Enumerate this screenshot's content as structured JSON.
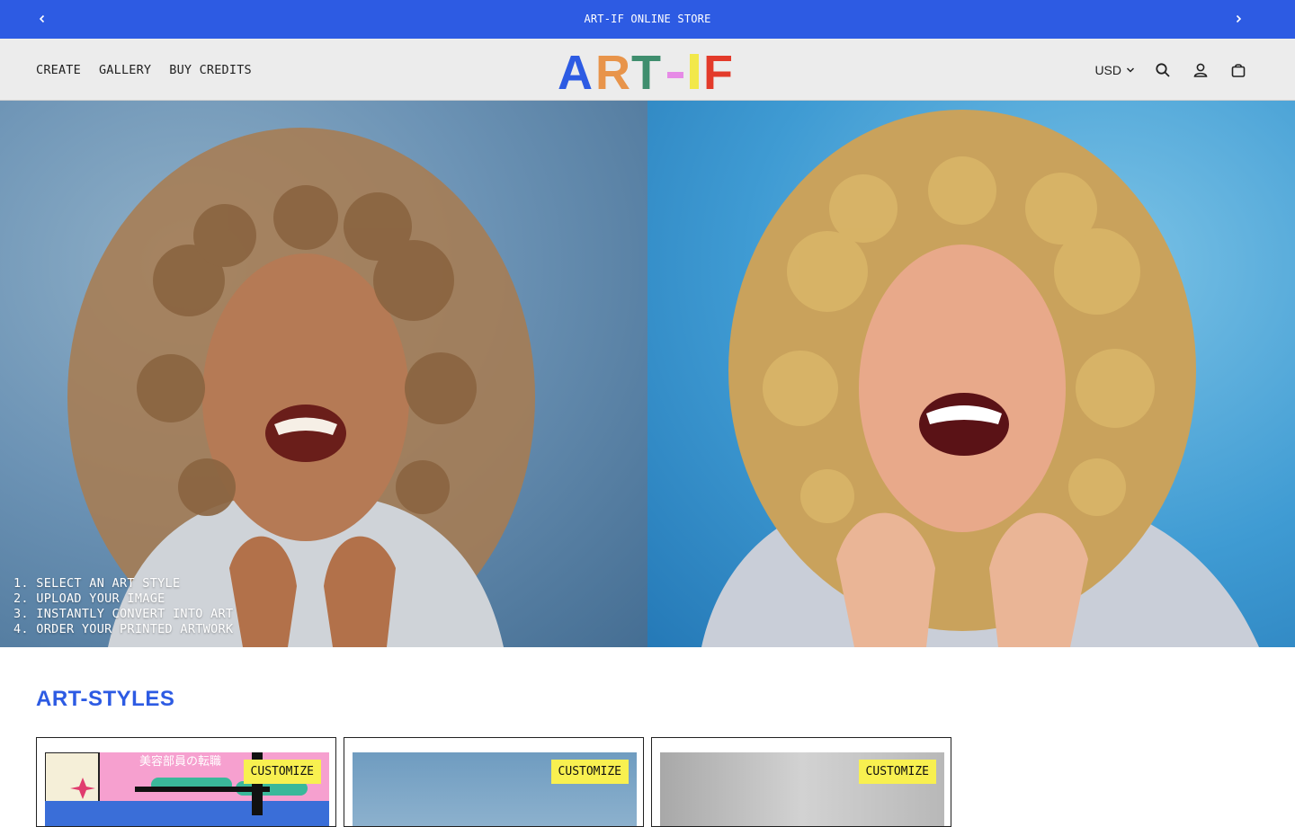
{
  "announcement": {
    "text": "ART-IF ONLINE STORE"
  },
  "nav": {
    "items": [
      "CREATE",
      "GALLERY",
      "BUY CREDITS"
    ]
  },
  "logo": {
    "text": "ART-IF",
    "letters": [
      "A",
      "R",
      "T",
      "-",
      "I",
      "F"
    ],
    "colors": [
      "#2d5be3",
      "#e8944a",
      "#3f8e6e",
      "#e68be6",
      "#f2e84a",
      "#e33a2a"
    ]
  },
  "header_tools": {
    "currency": "USD"
  },
  "hero": {
    "steps": [
      "1. SELECT AN ART STYLE",
      "2. UPLOAD YOUR IMAGE",
      "3. INSTANTLY CONVERT INTO ART",
      "4. ORDER YOUR PRINTED ARTWORK"
    ]
  },
  "art_styles": {
    "title": "ART-STYLES",
    "cards": [
      {
        "badge": "CUSTOMIZE",
        "banner_text": "美容部員の転職"
      },
      {
        "badge": "CUSTOMIZE"
      },
      {
        "badge": "CUSTOMIZE"
      }
    ]
  },
  "colors": {
    "accent": "#2d5be3",
    "badge": "#f8f050",
    "header_bg": "#ececec"
  },
  "icons": [
    "chevron-left-icon",
    "chevron-right-icon",
    "chevron-down-icon",
    "search-icon",
    "user-icon",
    "bag-icon"
  ]
}
